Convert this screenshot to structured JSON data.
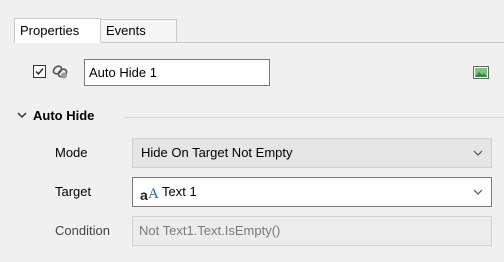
{
  "tabs": [
    {
      "label": "Properties",
      "active": true
    },
    {
      "label": "Events",
      "active": false
    }
  ],
  "object": {
    "enabled": true,
    "name_value": "Auto Hide 1"
  },
  "section": {
    "title": "Auto Hide",
    "expanded": true
  },
  "properties": {
    "mode": {
      "label": "Mode",
      "value": "Hide On Target Not Empty"
    },
    "target": {
      "label": "Target",
      "value": "Text 1"
    },
    "condition": {
      "label": "Condition",
      "value": "Not Text1.Text.IsEmpty()"
    }
  },
  "icons": {
    "link": "link-icon",
    "image": "image-icon",
    "text_object": "text-object-icon",
    "dropdown": "chevron-down-icon",
    "collapse": "chevron-down-icon",
    "checkbox": "checkbox-checked-icon"
  },
  "colors": {
    "window_bg": "#f0f0f0",
    "input_border": "#7a7a7a",
    "disabled_text": "#7a7a7a",
    "image_icon_green": "#2e8b3a"
  }
}
